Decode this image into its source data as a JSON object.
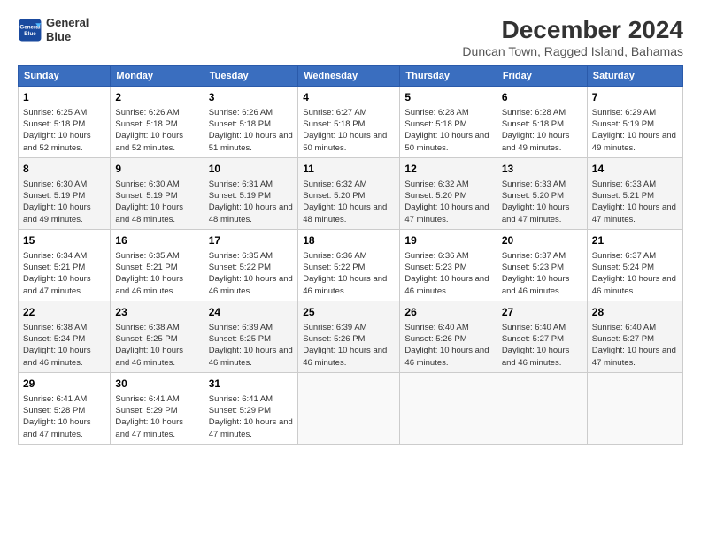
{
  "logo": {
    "line1": "General",
    "line2": "Blue"
  },
  "title": "December 2024",
  "subtitle": "Duncan Town, Ragged Island, Bahamas",
  "days_header": [
    "Sunday",
    "Monday",
    "Tuesday",
    "Wednesday",
    "Thursday",
    "Friday",
    "Saturday"
  ],
  "weeks": [
    [
      {
        "day": "1",
        "rise": "Sunrise: 6:25 AM",
        "set": "Sunset: 5:18 PM",
        "daylight": "Daylight: 10 hours and 52 minutes."
      },
      {
        "day": "2",
        "rise": "Sunrise: 6:26 AM",
        "set": "Sunset: 5:18 PM",
        "daylight": "Daylight: 10 hours and 52 minutes."
      },
      {
        "day": "3",
        "rise": "Sunrise: 6:26 AM",
        "set": "Sunset: 5:18 PM",
        "daylight": "Daylight: 10 hours and 51 minutes."
      },
      {
        "day": "4",
        "rise": "Sunrise: 6:27 AM",
        "set": "Sunset: 5:18 PM",
        "daylight": "Daylight: 10 hours and 50 minutes."
      },
      {
        "day": "5",
        "rise": "Sunrise: 6:28 AM",
        "set": "Sunset: 5:18 PM",
        "daylight": "Daylight: 10 hours and 50 minutes."
      },
      {
        "day": "6",
        "rise": "Sunrise: 6:28 AM",
        "set": "Sunset: 5:18 PM",
        "daylight": "Daylight: 10 hours and 49 minutes."
      },
      {
        "day": "7",
        "rise": "Sunrise: 6:29 AM",
        "set": "Sunset: 5:19 PM",
        "daylight": "Daylight: 10 hours and 49 minutes."
      }
    ],
    [
      {
        "day": "8",
        "rise": "Sunrise: 6:30 AM",
        "set": "Sunset: 5:19 PM",
        "daylight": "Daylight: 10 hours and 49 minutes."
      },
      {
        "day": "9",
        "rise": "Sunrise: 6:30 AM",
        "set": "Sunset: 5:19 PM",
        "daylight": "Daylight: 10 hours and 48 minutes."
      },
      {
        "day": "10",
        "rise": "Sunrise: 6:31 AM",
        "set": "Sunset: 5:19 PM",
        "daylight": "Daylight: 10 hours and 48 minutes."
      },
      {
        "day": "11",
        "rise": "Sunrise: 6:32 AM",
        "set": "Sunset: 5:20 PM",
        "daylight": "Daylight: 10 hours and 48 minutes."
      },
      {
        "day": "12",
        "rise": "Sunrise: 6:32 AM",
        "set": "Sunset: 5:20 PM",
        "daylight": "Daylight: 10 hours and 47 minutes."
      },
      {
        "day": "13",
        "rise": "Sunrise: 6:33 AM",
        "set": "Sunset: 5:20 PM",
        "daylight": "Daylight: 10 hours and 47 minutes."
      },
      {
        "day": "14",
        "rise": "Sunrise: 6:33 AM",
        "set": "Sunset: 5:21 PM",
        "daylight": "Daylight: 10 hours and 47 minutes."
      }
    ],
    [
      {
        "day": "15",
        "rise": "Sunrise: 6:34 AM",
        "set": "Sunset: 5:21 PM",
        "daylight": "Daylight: 10 hours and 47 minutes."
      },
      {
        "day": "16",
        "rise": "Sunrise: 6:35 AM",
        "set": "Sunset: 5:21 PM",
        "daylight": "Daylight: 10 hours and 46 minutes."
      },
      {
        "day": "17",
        "rise": "Sunrise: 6:35 AM",
        "set": "Sunset: 5:22 PM",
        "daylight": "Daylight: 10 hours and 46 minutes."
      },
      {
        "day": "18",
        "rise": "Sunrise: 6:36 AM",
        "set": "Sunset: 5:22 PM",
        "daylight": "Daylight: 10 hours and 46 minutes."
      },
      {
        "day": "19",
        "rise": "Sunrise: 6:36 AM",
        "set": "Sunset: 5:23 PM",
        "daylight": "Daylight: 10 hours and 46 minutes."
      },
      {
        "day": "20",
        "rise": "Sunrise: 6:37 AM",
        "set": "Sunset: 5:23 PM",
        "daylight": "Daylight: 10 hours and 46 minutes."
      },
      {
        "day": "21",
        "rise": "Sunrise: 6:37 AM",
        "set": "Sunset: 5:24 PM",
        "daylight": "Daylight: 10 hours and 46 minutes."
      }
    ],
    [
      {
        "day": "22",
        "rise": "Sunrise: 6:38 AM",
        "set": "Sunset: 5:24 PM",
        "daylight": "Daylight: 10 hours and 46 minutes."
      },
      {
        "day": "23",
        "rise": "Sunrise: 6:38 AM",
        "set": "Sunset: 5:25 PM",
        "daylight": "Daylight: 10 hours and 46 minutes."
      },
      {
        "day": "24",
        "rise": "Sunrise: 6:39 AM",
        "set": "Sunset: 5:25 PM",
        "daylight": "Daylight: 10 hours and 46 minutes."
      },
      {
        "day": "25",
        "rise": "Sunrise: 6:39 AM",
        "set": "Sunset: 5:26 PM",
        "daylight": "Daylight: 10 hours and 46 minutes."
      },
      {
        "day": "26",
        "rise": "Sunrise: 6:40 AM",
        "set": "Sunset: 5:26 PM",
        "daylight": "Daylight: 10 hours and 46 minutes."
      },
      {
        "day": "27",
        "rise": "Sunrise: 6:40 AM",
        "set": "Sunset: 5:27 PM",
        "daylight": "Daylight: 10 hours and 46 minutes."
      },
      {
        "day": "28",
        "rise": "Sunrise: 6:40 AM",
        "set": "Sunset: 5:27 PM",
        "daylight": "Daylight: 10 hours and 47 minutes."
      }
    ],
    [
      {
        "day": "29",
        "rise": "Sunrise: 6:41 AM",
        "set": "Sunset: 5:28 PM",
        "daylight": "Daylight: 10 hours and 47 minutes."
      },
      {
        "day": "30",
        "rise": "Sunrise: 6:41 AM",
        "set": "Sunset: 5:29 PM",
        "daylight": "Daylight: 10 hours and 47 minutes."
      },
      {
        "day": "31",
        "rise": "Sunrise: 6:41 AM",
        "set": "Sunset: 5:29 PM",
        "daylight": "Daylight: 10 hours and 47 minutes."
      },
      null,
      null,
      null,
      null
    ]
  ]
}
